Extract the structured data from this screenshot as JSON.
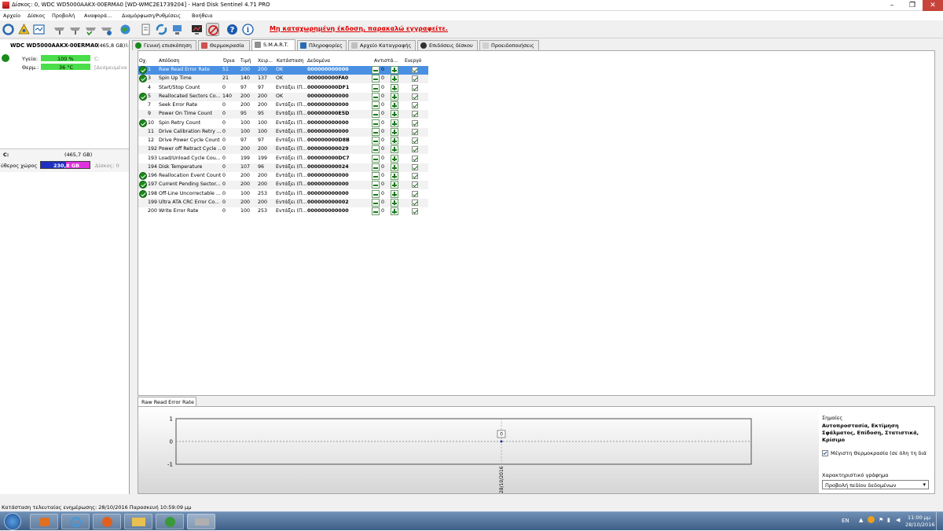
{
  "window": {
    "title": "Δίσκος: 0, WDC WD5000AAKX-00ERMA0 [WD-WMC2E1739204]  -  Hard Disk Sentinel 4.71 PRO"
  },
  "menu": [
    "Αρχείο",
    "Δίσκος",
    "Προβολή",
    "Αναφορά...",
    "Διαμόρφωση/Ρυθμίσεις",
    "Βοήθεια"
  ],
  "toolbar": {
    "register_text": "Μη καταχωρημένη έκδοση, παρακαλώ εγγραφείτε."
  },
  "left": {
    "disk_name": "WDC WD5000AAKX-00ERMA0",
    "disk_size": "(465,8 GB)",
    "disk_suffix": "l:",
    "health_label": "Υγεία:",
    "health_value": "100 %",
    "health_drive": "C:",
    "temp_label": "Θερμ.:",
    "temp_value": "36 °C",
    "temp_note": "[Δεσμευμένα",
    "vol_name": "C:",
    "vol_size": "(465,7 GB)",
    "free_label": "ύθερος χώρος",
    "free_value": "230,8 GB",
    "free_disk": "Δίσκος: 0"
  },
  "tabs": [
    "Γενική επισκόπηση",
    "Θερμοκρασία",
    "S.M.A.R.T.",
    "Πληροφορίες",
    "Αρχείο Καταγραφής",
    "Επιδόσεις δίσκου",
    "Προειδοποιήσεις"
  ],
  "columns": [
    "Οχ.",
    "Απόδοση",
    "Όρια",
    "Τιμή",
    "Χειρ...",
    "Κατάσταση",
    "Δεδομένα",
    "Αντιστά...",
    "Ενεργό"
  ],
  "rows": [
    {
      "id": "1",
      "name": "Raw Read Error Rate",
      "thr": "51",
      "val": "200",
      "worst": "200",
      "status": "OK",
      "data": "000000000000",
      "adj": "0",
      "ok": true
    },
    {
      "id": "3",
      "name": "Spin Up Time",
      "thr": "21",
      "val": "140",
      "worst": "137",
      "status": "OK",
      "data": "000000000FA0",
      "adj": "0",
      "ok": true
    },
    {
      "id": "4",
      "name": "Start/Stop Count",
      "thr": "0",
      "val": "97",
      "worst": "97",
      "status": "Εντάξει (Π...",
      "data": "000000000DF1",
      "adj": "0",
      "ok": false
    },
    {
      "id": "5",
      "name": "Reallocated Sectors Co...",
      "thr": "140",
      "val": "200",
      "worst": "200",
      "status": "OK",
      "data": "000000000000",
      "adj": "0",
      "ok": true
    },
    {
      "id": "7",
      "name": "Seek Error Rate",
      "thr": "0",
      "val": "200",
      "worst": "200",
      "status": "Εντάξει (Π...",
      "data": "000000000000",
      "adj": "0",
      "ok": false
    },
    {
      "id": "9",
      "name": "Power On Time Count",
      "thr": "0",
      "val": "95",
      "worst": "95",
      "status": "Εντάξει (Π...",
      "data": "000000000E5D",
      "adj": "0",
      "ok": false
    },
    {
      "id": "10",
      "name": "Spin Retry Count",
      "thr": "0",
      "val": "100",
      "worst": "100",
      "status": "Εντάξει (Π...",
      "data": "000000000000",
      "adj": "0",
      "ok": true
    },
    {
      "id": "11",
      "name": "Drive Calibration Retry ...",
      "thr": "0",
      "val": "100",
      "worst": "100",
      "status": "Εντάξει (Π...",
      "data": "000000000000",
      "adj": "0",
      "ok": false
    },
    {
      "id": "12",
      "name": "Drive Power Cycle Count",
      "thr": "0",
      "val": "97",
      "worst": "97",
      "status": "Εντάξει (Π...",
      "data": "000000000D8B",
      "adj": "0",
      "ok": false
    },
    {
      "id": "192",
      "name": "Power off Retract Cycle ...",
      "thr": "0",
      "val": "200",
      "worst": "200",
      "status": "Εντάξει (Π...",
      "data": "000000000029",
      "adj": "0",
      "ok": false
    },
    {
      "id": "193",
      "name": "Load/Unload Cycle Cou...",
      "thr": "0",
      "val": "199",
      "worst": "199",
      "status": "Εντάξει (Π...",
      "data": "000000000DC7",
      "adj": "0",
      "ok": false
    },
    {
      "id": "194",
      "name": "Disk Temperature",
      "thr": "0",
      "val": "107",
      "worst": "96",
      "status": "Εντάξει (Π...",
      "data": "000000000024",
      "adj": "0",
      "ok": false
    },
    {
      "id": "196",
      "name": "Reallocation Event Count",
      "thr": "0",
      "val": "200",
      "worst": "200",
      "status": "Εντάξει (Π...",
      "data": "000000000000",
      "adj": "0",
      "ok": true
    },
    {
      "id": "197",
      "name": "Current Pending Sector...",
      "thr": "0",
      "val": "200",
      "worst": "200",
      "status": "Εντάξει (Π...",
      "data": "000000000000",
      "adj": "0",
      "ok": true
    },
    {
      "id": "198",
      "name": "Off-Line Uncorrectable ...",
      "thr": "0",
      "val": "100",
      "worst": "253",
      "status": "Εντάξει (Π...",
      "data": "000000000000",
      "adj": "0",
      "ok": true
    },
    {
      "id": "199",
      "name": "Ultra ATA CRC Error Co...",
      "thr": "0",
      "val": "200",
      "worst": "200",
      "status": "Εντάξει (Π...",
      "data": "000000000002",
      "adj": "0",
      "ok": false
    },
    {
      "id": "200",
      "name": "Write Error Rate",
      "thr": "0",
      "val": "100",
      "worst": "253",
      "status": "Εντάξει (Π...",
      "data": "000000000000",
      "adj": "0",
      "ok": false
    }
  ],
  "graph": {
    "tab": "Raw Read Error Rate",
    "notes_label": "Σημαίες",
    "notes_text": "Αυτοπροστασία, Εκτίμηση Σφάλματος, Επίδοση, Στατιστικά, Κρίσιμο",
    "max_temp_label": "Μέγιστη Θερμοκρασία (σε όλη τη διά",
    "chart_label": "Χαρακτηριστικό γράφημα",
    "chart_select": "Προβολή πεδίου δεδομένων"
  },
  "chart_data": {
    "type": "line",
    "x": [
      "28/10/2016"
    ],
    "series": [
      {
        "values": [
          0
        ]
      }
    ],
    "ylim": [
      -1,
      1
    ],
    "yticks": [
      "1",
      "0",
      "-1"
    ],
    "data_labels": [
      "0"
    ]
  },
  "status": {
    "text": "Κατάσταση τελευταίας ενημέρωσης: 28/10/2016 Παρασκευή 10:59:09 μμ"
  },
  "taskbar": {
    "lang": "EN",
    "time": "11:00 μμ",
    "date": "28/10/2016"
  }
}
